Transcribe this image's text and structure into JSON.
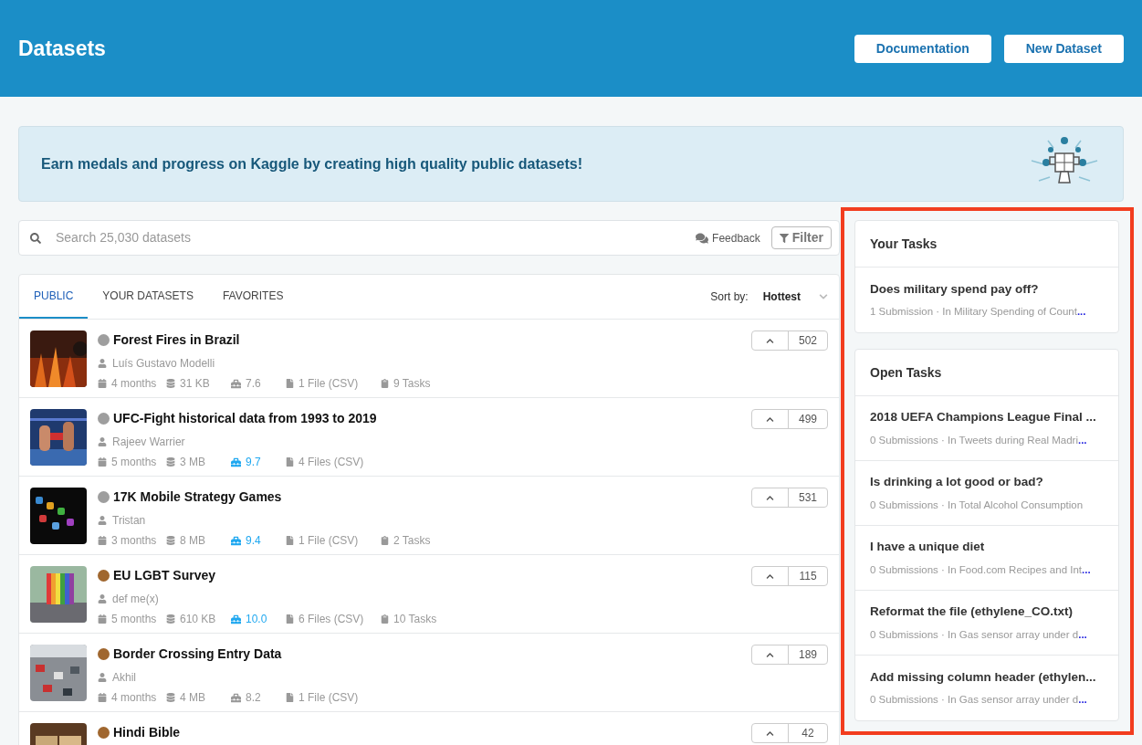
{
  "header": {
    "title": "Datasets",
    "buttons": [
      "Documentation",
      "New Dataset"
    ]
  },
  "banner": {
    "text": "Earn medals and progress on Kaggle by creating high quality public datasets!"
  },
  "search": {
    "placeholder": "Search 25,030 datasets",
    "feedback": "Feedback",
    "filter": "Filter"
  },
  "tabs": [
    {
      "label": "PUBLIC",
      "selected": true
    },
    {
      "label": "YOUR DATASETS",
      "selected": false
    },
    {
      "label": "FAVORITES",
      "selected": false
    }
  ],
  "sort": {
    "label": "Sort by:",
    "value": "Hottest"
  },
  "datasets": [
    {
      "title": "Forest Fires in Brazil",
      "color": "#9e9e9e",
      "author": "Luís Gustavo Modelli",
      "age": "4 months",
      "size": "31 KB",
      "usability": "7.6",
      "usability_high": false,
      "files": "1 File (CSV)",
      "tasks": "9 Tasks",
      "votes": "502"
    },
    {
      "title": "UFC-Fight historical data from 1993 to 2019",
      "color": "#9e9e9e",
      "author": "Rajeev Warrier",
      "age": "5 months",
      "size": "3 MB",
      "usability": "9.7",
      "usability_high": true,
      "files": "4 Files (CSV)",
      "votes": "499"
    },
    {
      "title": "17K Mobile Strategy Games",
      "color": "#9e9e9e",
      "author": "Tristan",
      "age": "3 months",
      "size": "8 MB",
      "usability": "9.4",
      "usability_high": true,
      "files": "1 File (CSV)",
      "tasks": "2 Tasks",
      "votes": "531"
    },
    {
      "title": "EU LGBT Survey",
      "color": "#a0672f",
      "author": "def me(x)",
      "age": "5 months",
      "size": "610 KB",
      "usability": "10.0",
      "usability_high": true,
      "files": "6 Files (CSV)",
      "tasks": "10 Tasks",
      "votes": "115"
    },
    {
      "title": "Border Crossing Entry Data",
      "color": "#a0672f",
      "author": "Akhil",
      "age": "4 months",
      "size": "4 MB",
      "usability": "8.2",
      "usability_high": false,
      "files": "1 File (CSV)",
      "votes": "189"
    },
    {
      "title": "Hindi Bible",
      "color": "#a0672f",
      "votes": "42"
    }
  ],
  "your_tasks": {
    "title": "Your Tasks",
    "items": [
      {
        "title": "Does military spend pay off?",
        "meta": "1 Submission · In Military Spending of Count",
        "more": "..."
      }
    ]
  },
  "open_tasks": {
    "title": "Open Tasks",
    "items": [
      {
        "title": "2018 UEFA Champions League Final ...",
        "meta": "0 Submissions · In Tweets during Real Madri",
        "more": "..."
      },
      {
        "title": "Is drinking a lot good or bad?",
        "meta": "0 Submissions · In Total Alcohol Consumption"
      },
      {
        "title": "I have a unique diet",
        "meta": "0 Submissions · In Food.com Recipes and Int",
        "more": "..."
      },
      {
        "title": "Reformat the file (ethylene_CO.txt)",
        "meta": "0 Submissions · In Gas sensor array under d",
        "more": "..."
      },
      {
        "title": "Add missing column header (ethylen...",
        "meta": "0 Submissions · In Gas sensor array under d",
        "more": "..."
      }
    ]
  }
}
